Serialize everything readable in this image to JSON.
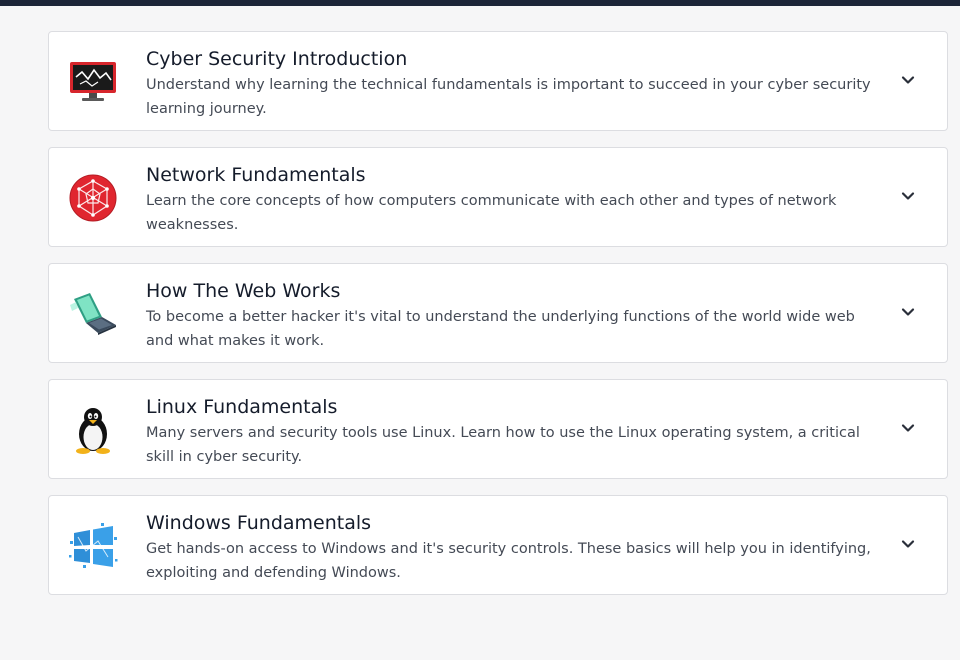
{
  "modules": [
    {
      "title": "Cyber Security Introduction",
      "description": "Understand why learning the technical fundamentals is important to succeed in your cyber security learning journey.",
      "icon": "hacked-monitor-icon"
    },
    {
      "title": "Network Fundamentals",
      "description": "Learn the core concepts of how computers communicate with each other and types of network weaknesses.",
      "icon": "network-globe-icon"
    },
    {
      "title": "How The Web Works",
      "description": "To become a better hacker it's vital to understand the underlying functions of the world wide web and what makes it work.",
      "icon": "laptop-icon"
    },
    {
      "title": "Linux Fundamentals",
      "description": "Many servers and security tools use Linux. Learn how to use the Linux operating system, a critical skill in cyber security.",
      "icon": "linux-penguin-icon"
    },
    {
      "title": "Windows Fundamentals",
      "description": "Get hands-on access to Windows and it's security controls. These basics will help you in identifying, exploiting and defending Windows.",
      "icon": "windows-logo-icon"
    }
  ],
  "colors": {
    "topbar": "#1c2538",
    "background": "#f6f6f7",
    "card": "#ffffff",
    "border": "#dcdde1",
    "title": "#151c2b",
    "description": "#444a55"
  }
}
